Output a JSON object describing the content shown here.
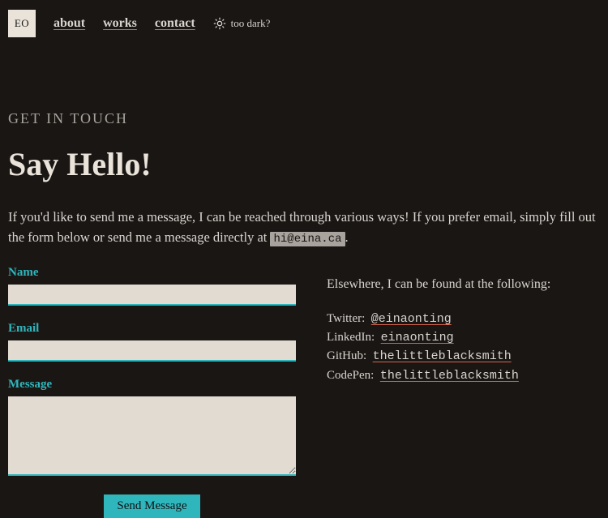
{
  "nav": {
    "logo": "EO",
    "links": [
      "about",
      "works",
      "contact"
    ],
    "theme_toggle_label": "too dark?"
  },
  "section": {
    "eyebrow": "GET IN TOUCH",
    "heading": "Say Hello!",
    "intro_before": "If you'd like to send me a message, I can be reached through various ways! If you prefer email, simply fill out the form below or send me a message directly at ",
    "email": "hi@eina.ca",
    "intro_after": "."
  },
  "form": {
    "name_label": "Name",
    "email_label": "Email",
    "message_label": "Message",
    "submit_label": "Send Message",
    "name_value": "",
    "email_value": "",
    "message_value": ""
  },
  "elsewhere": {
    "intro": "Elsewhere, I can be found at the following:",
    "items": [
      {
        "platform": "Twitter:",
        "handle": "@einaonting"
      },
      {
        "platform": "LinkedIn:",
        "handle": "einaonting"
      },
      {
        "platform": "GitHub:",
        "handle": "thelittleblacksmith"
      },
      {
        "platform": "CodePen:",
        "handle": "thelittleblacksmith"
      }
    ]
  }
}
